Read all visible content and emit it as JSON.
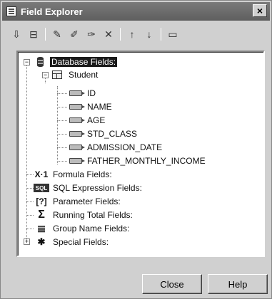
{
  "window": {
    "title": "Field Explorer",
    "close_glyph": "×"
  },
  "toolbar": {
    "buttons": [
      {
        "icon": "insert-to-report-icon",
        "glyph": "⇩"
      },
      {
        "icon": "browse-field-icon",
        "glyph": "⊟"
      },
      {
        "icon": "new-icon",
        "glyph": "✎"
      },
      {
        "icon": "edit-icon",
        "glyph": "✐"
      },
      {
        "icon": "rename-icon",
        "glyph": "✑"
      },
      {
        "icon": "delete-icon",
        "glyph": "✕"
      },
      {
        "icon": "move-up-icon",
        "glyph": "↑"
      },
      {
        "icon": "move-down-icon",
        "glyph": "↓"
      },
      {
        "icon": "show-field-type-icon",
        "glyph": "▭"
      }
    ]
  },
  "tree": {
    "database_fields": "Database Fields:",
    "table": "Student",
    "fields": [
      "ID",
      "NAME",
      "AGE",
      "STD_CLASS",
      "ADMISSION_DATE",
      "FATHER_MONTHLY_INCOME"
    ],
    "formula_fields": "Formula Fields:",
    "sql_expression_fields": "SQL Expression Fields:",
    "parameter_fields": "Parameter Fields:",
    "running_total_fields": "Running Total Fields:",
    "group_name_fields": "Group Name Fields:",
    "special_fields": "Special Fields:",
    "glyphs": {
      "formula": "X·1",
      "sql": "SQL",
      "parameter": "[?]",
      "running_total": "Σ",
      "group_name": "≣",
      "special": "✱",
      "minus": "−",
      "plus": "+"
    }
  },
  "footer": {
    "close_label": "Close",
    "help_label": "Help"
  }
}
